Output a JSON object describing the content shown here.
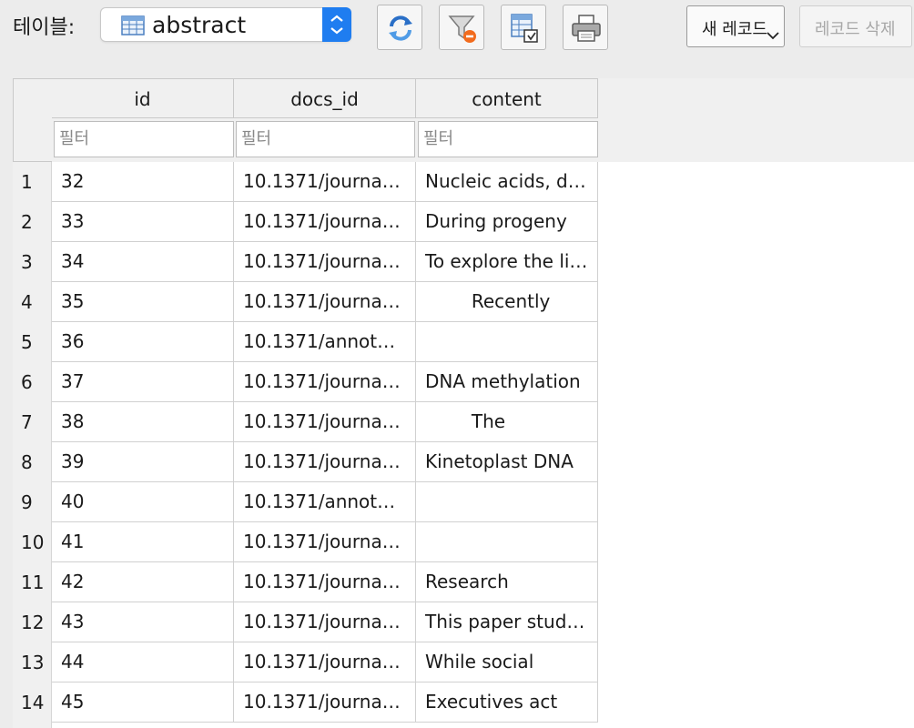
{
  "toolbar": {
    "table_label": "테이블:",
    "table_select_value": "abstract",
    "new_record_label": "새 레코드",
    "delete_record_label": "레코드 삭제",
    "icons": [
      "table-icon",
      "refresh-icon",
      "clear-filters-icon",
      "save-table-icon",
      "print-icon"
    ]
  },
  "grid": {
    "columns": [
      "id",
      "docs_id",
      "content"
    ],
    "filter_placeholder": "필터",
    "rows": [
      {
        "num": "1",
        "id": "32",
        "docs_id": "10.1371/journa…",
        "content": "Nucleic acids, d…"
      },
      {
        "num": "2",
        "id": "33",
        "docs_id": "10.1371/journa…",
        "content": "During progeny"
      },
      {
        "num": "3",
        "id": "34",
        "docs_id": "10.1371/journa…",
        "content": "To explore the li…"
      },
      {
        "num": "4",
        "id": "35",
        "docs_id": "10.1371/journa…",
        "content": "        Recently"
      },
      {
        "num": "5",
        "id": "36",
        "docs_id": "10.1371/annot…",
        "content": ""
      },
      {
        "num": "6",
        "id": "37",
        "docs_id": "10.1371/journa…",
        "content": "DNA methylation"
      },
      {
        "num": "7",
        "id": "38",
        "docs_id": "10.1371/journa…",
        "content": "        The"
      },
      {
        "num": "8",
        "id": "39",
        "docs_id": "10.1371/journa…",
        "content": "Kinetoplast DNA"
      },
      {
        "num": "9",
        "id": "40",
        "docs_id": "10.1371/annot…",
        "content": ""
      },
      {
        "num": "10",
        "id": "41",
        "docs_id": "10.1371/journa…",
        "content": ""
      },
      {
        "num": "11",
        "id": "42",
        "docs_id": "10.1371/journa…",
        "content": "Research"
      },
      {
        "num": "12",
        "id": "43",
        "docs_id": "10.1371/journa…",
        "content": "This paper studi…"
      },
      {
        "num": "13",
        "id": "44",
        "docs_id": "10.1371/journa…",
        "content": "While social"
      },
      {
        "num": "14",
        "id": "45",
        "docs_id": "10.1371/journa…",
        "content": "Executives act"
      }
    ]
  },
  "colors": {
    "accent": "#1f7df0",
    "header_bg": "#f0f0f0",
    "toolbar_bg": "#ececec"
  }
}
